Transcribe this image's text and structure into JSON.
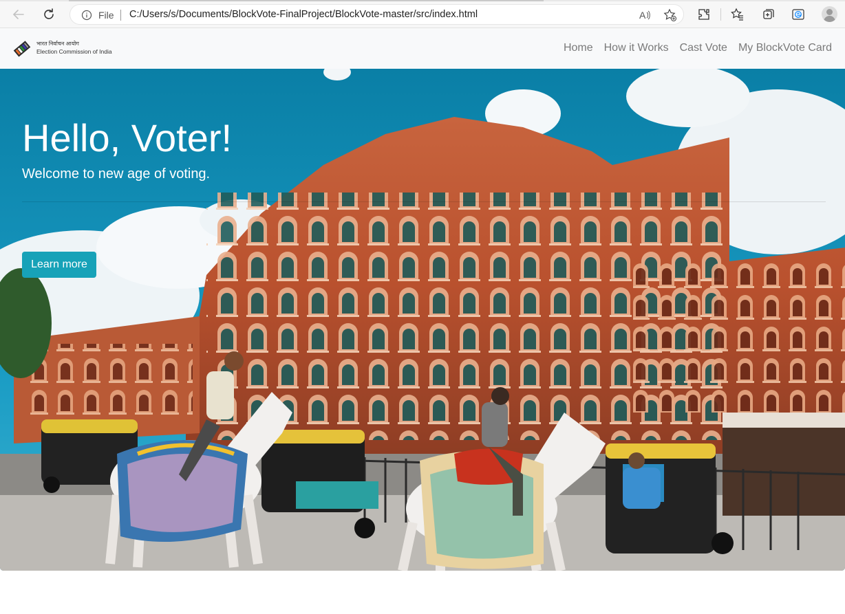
{
  "browser": {
    "file_label": "File",
    "url": "C:/Users/s/Documents/BlockVote-FinalProject/BlockVote-master/src/index.html",
    "read_aloud_label": "A̅"
  },
  "brand": {
    "hindi_name": "भारत निर्वाचन आयोग",
    "english_name": "Election Commission of India"
  },
  "nav": {
    "items": [
      {
        "label": "Home"
      },
      {
        "label": "How it Works"
      },
      {
        "label": "Cast Vote"
      },
      {
        "label": "My BlockVote Card"
      }
    ]
  },
  "hero": {
    "title": "Hello, Voter!",
    "lead": "Welcome to new age of voting.",
    "button_label": "Learn more",
    "button_color": "#17a2b8",
    "background": "photo-hawa-mahal-jaipur"
  },
  "icons": {
    "back": "back-arrow-icon",
    "refresh": "refresh-icon",
    "info": "info-icon",
    "read_aloud": "read-aloud-icon",
    "add_favorite": "add-favorite-icon",
    "extensions": "extensions-icon",
    "favorites": "favorites-icon",
    "collections": "collections-icon",
    "edge": "edge-icon",
    "profile": "profile-icon"
  }
}
